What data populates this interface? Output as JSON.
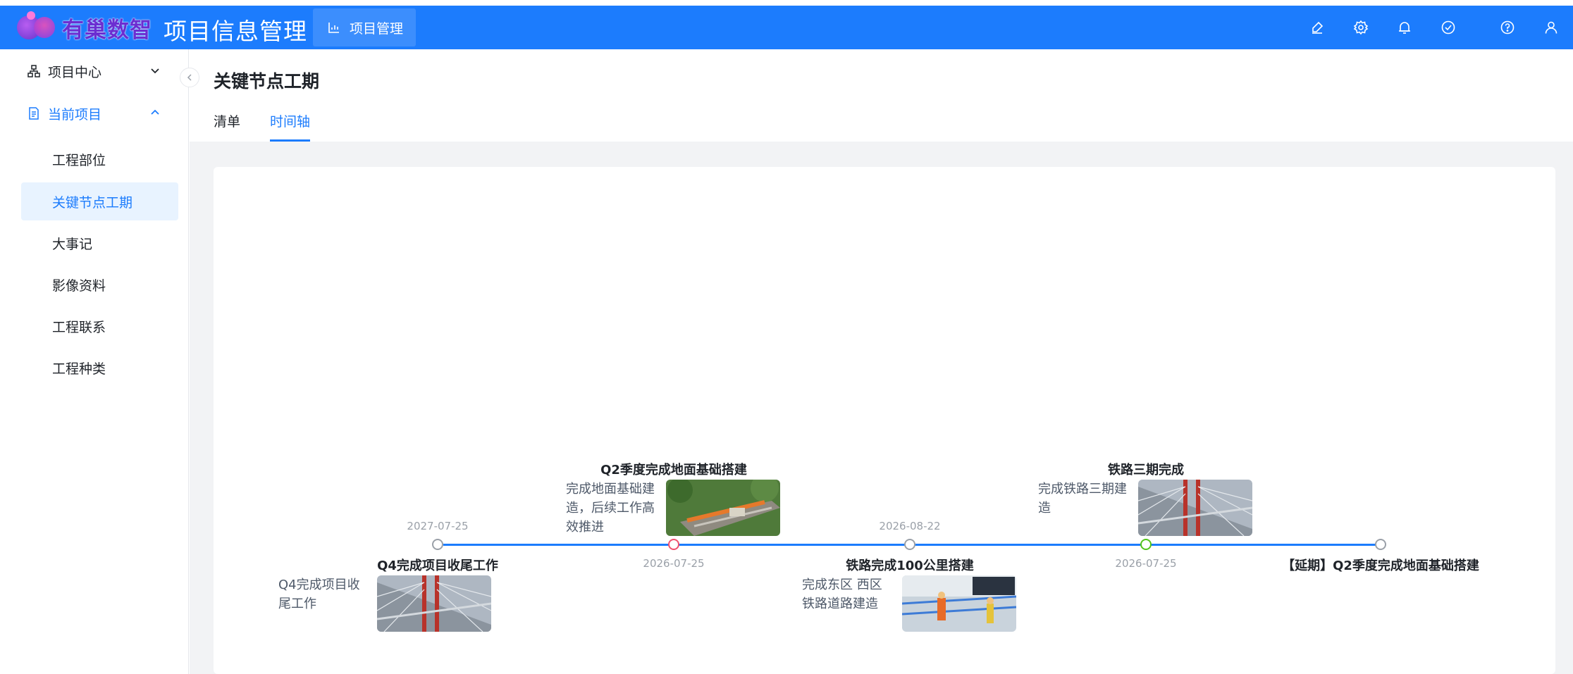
{
  "header": {
    "logo_text": "有巢数智",
    "app_title": "项目信息管理",
    "menu_button": "项目管理",
    "icons": [
      "brush-icon",
      "gear-icon",
      "bell-icon",
      "check-circle-icon",
      "help-icon",
      "user-icon"
    ]
  },
  "sidebar": {
    "groups": [
      {
        "label": "项目中心",
        "expanded": false
      },
      {
        "label": "当前项目",
        "expanded": true
      }
    ],
    "items": [
      {
        "label": "工程部位"
      },
      {
        "label": "关键节点工期",
        "active": true
      },
      {
        "label": "大事记"
      },
      {
        "label": "影像资料"
      },
      {
        "label": "工程联系"
      },
      {
        "label": "工程种类"
      }
    ]
  },
  "page": {
    "title": "关键节点工期",
    "tabs": [
      {
        "label": "清单",
        "active": false
      },
      {
        "label": "时间轴",
        "active": true
      }
    ]
  },
  "timeline": {
    "events": [
      {
        "date": "2027-07-25",
        "title": "Q4完成项目收尾工作",
        "desc": "Q4完成项目收尾工作",
        "node_color": "#9aa0a8",
        "image": "bridge-photo"
      },
      {
        "date": "2026-07-25",
        "title": "Q2季度完成地面基础搭建",
        "desc": "完成地面基础建造，后续工作高效推进",
        "node_color": "#f0506e",
        "image": "aerial-construction-photo"
      },
      {
        "date": "2026-08-22",
        "title": "铁路完成100公里搭建",
        "desc": "完成东区 西区铁路道路建造",
        "node_color": "#9aa0a8",
        "image": "workers-photo"
      },
      {
        "date": "2026-07-25",
        "title": "铁路三期完成",
        "desc": "完成铁路三期建造",
        "node_color": "#52c41a",
        "image": "bridge-photo"
      },
      {
        "date": "",
        "title": "【延期】Q2季度完成地面基础搭建",
        "desc": "",
        "node_color": "#9aa0a8",
        "image": ""
      }
    ]
  },
  "colors": {
    "primary": "#1c7cfd",
    "active_bg": "#e8f3ff",
    "text": "#1f2329",
    "muted": "#9aa0a8"
  }
}
